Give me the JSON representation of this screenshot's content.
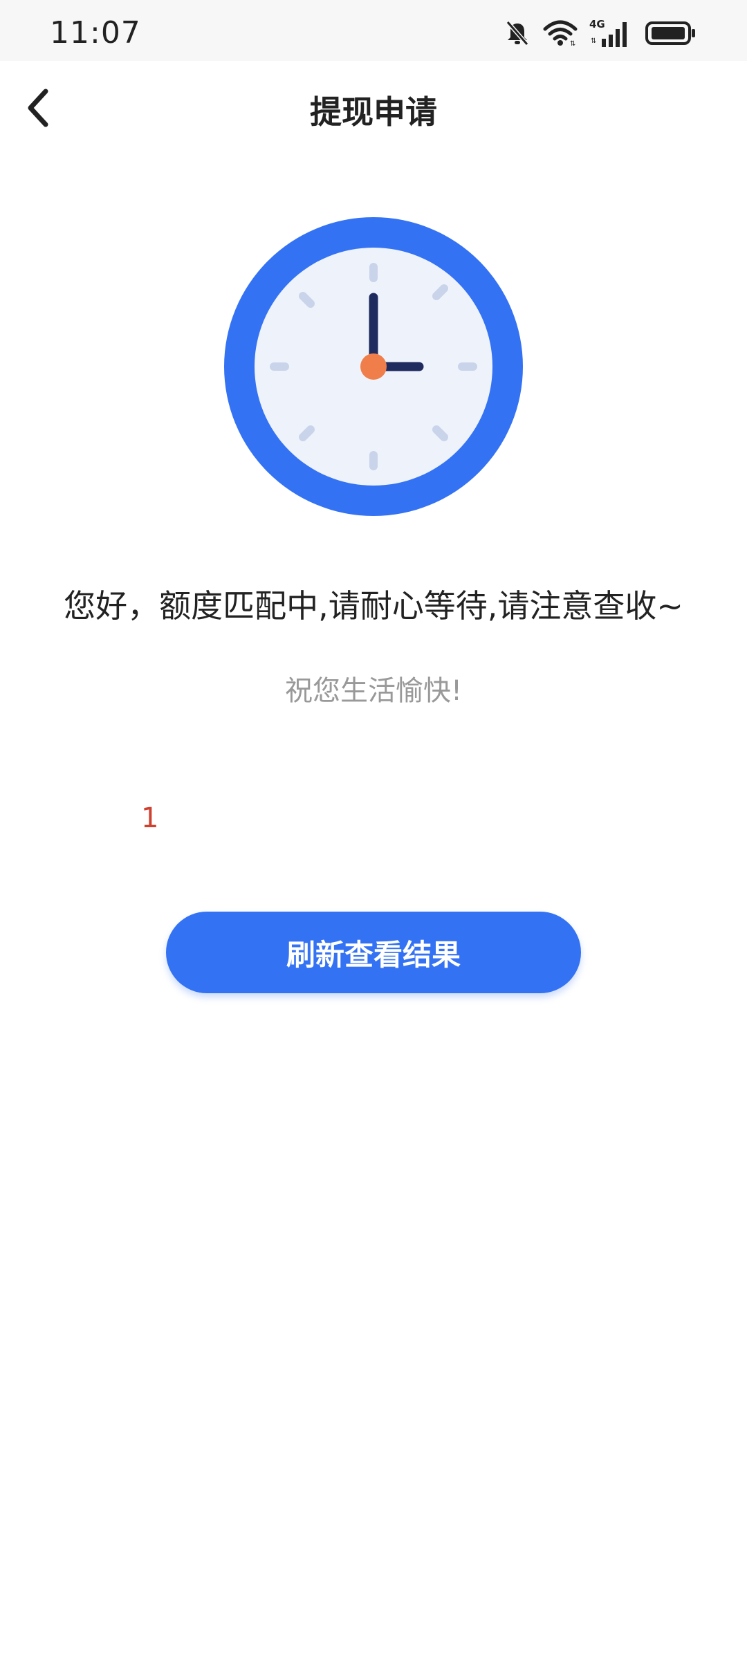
{
  "status_bar": {
    "time": "11:07",
    "icons": [
      "bell-muted-icon",
      "wifi-icon",
      "signal-4g-icon",
      "battery-icon"
    ],
    "network_label": "4G"
  },
  "nav": {
    "title": "提现申请",
    "back_icon": "chevron-left-icon"
  },
  "illustration": {
    "icon": "clock-icon",
    "colors": {
      "ring": "#3472f4",
      "face": "#eef3fb",
      "hands": "#1f2b5e",
      "center": "#ef7e4a",
      "ticks": "#c9d4ea"
    }
  },
  "content": {
    "message": "您好，额度匹配中,请耐心等待,请注意查收~",
    "greeting": "祝您生活愉快!",
    "counter": "1"
  },
  "actions": {
    "refresh_label": "刷新查看结果"
  },
  "colors": {
    "accent": "#3472f4",
    "counter": "#d0402e",
    "secondary_text": "#999999"
  }
}
